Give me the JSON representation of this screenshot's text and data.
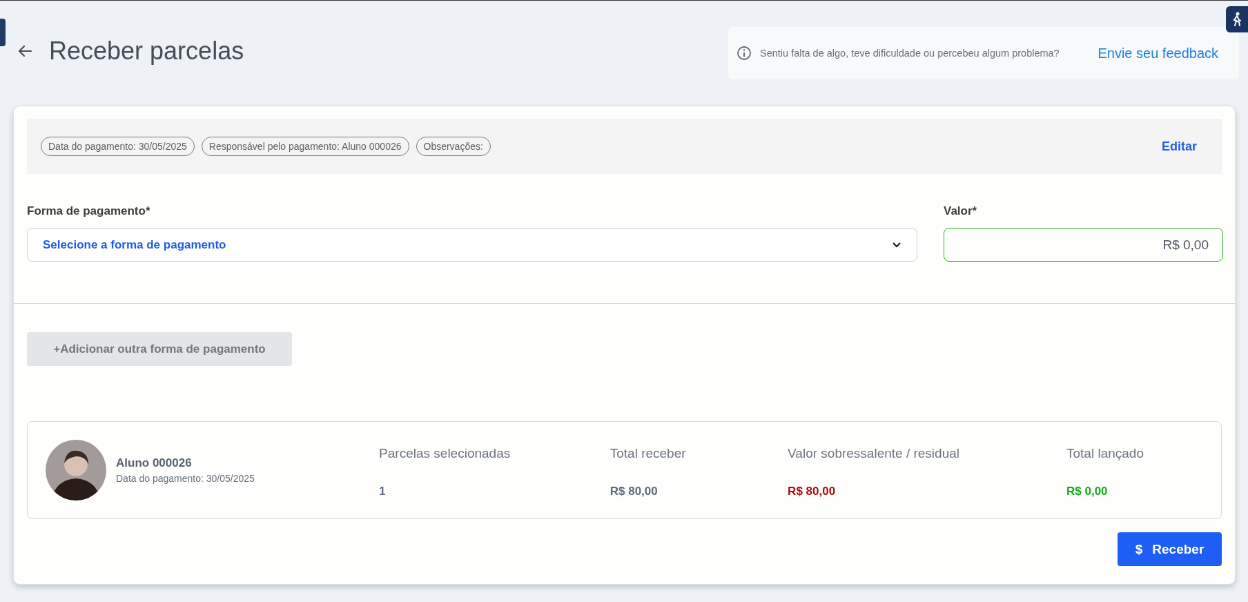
{
  "header": {
    "title": "Receber parcelas",
    "feedback": {
      "message": "Sentiu falta de algo, teve dificuldade ou percebeu algum problema?",
      "link": "Envie seu feedback"
    }
  },
  "details": {
    "chips": [
      "Data do pagamento: 30/05/2025",
      "Responsável pelo pagamento: Aluno 000026",
      "Observações:"
    ],
    "edit": "Editar"
  },
  "payment": {
    "method": {
      "label": "Forma de pagamento*",
      "placeholder": "Selecione a forma de pagamento"
    },
    "amount": {
      "label": "Valor*",
      "value": "R$ 0,00",
      "valid": true
    }
  },
  "add_button": {
    "label": "+Adicionar outra forma de pagamento",
    "disabled": true
  },
  "summary": {
    "student": {
      "name": "Aluno 000026",
      "subtitle": "Data do pagamento: 30/05/2025"
    },
    "metrics": [
      {
        "label": "Parcelas selecionadas",
        "value": "1",
        "color": "#5f6b7a"
      },
      {
        "label": "Total receber",
        "value": "R$ 80,00",
        "color": "#5f6b7a"
      },
      {
        "label": "Valor sobressalente / residual",
        "value": "R$ 80,00",
        "color": "#b00a0a"
      },
      {
        "label": "Total lançado",
        "value": "R$ 0,00",
        "color": "#1aaa1a"
      }
    ]
  },
  "submit": {
    "icon": "$",
    "label": "Receber"
  }
}
